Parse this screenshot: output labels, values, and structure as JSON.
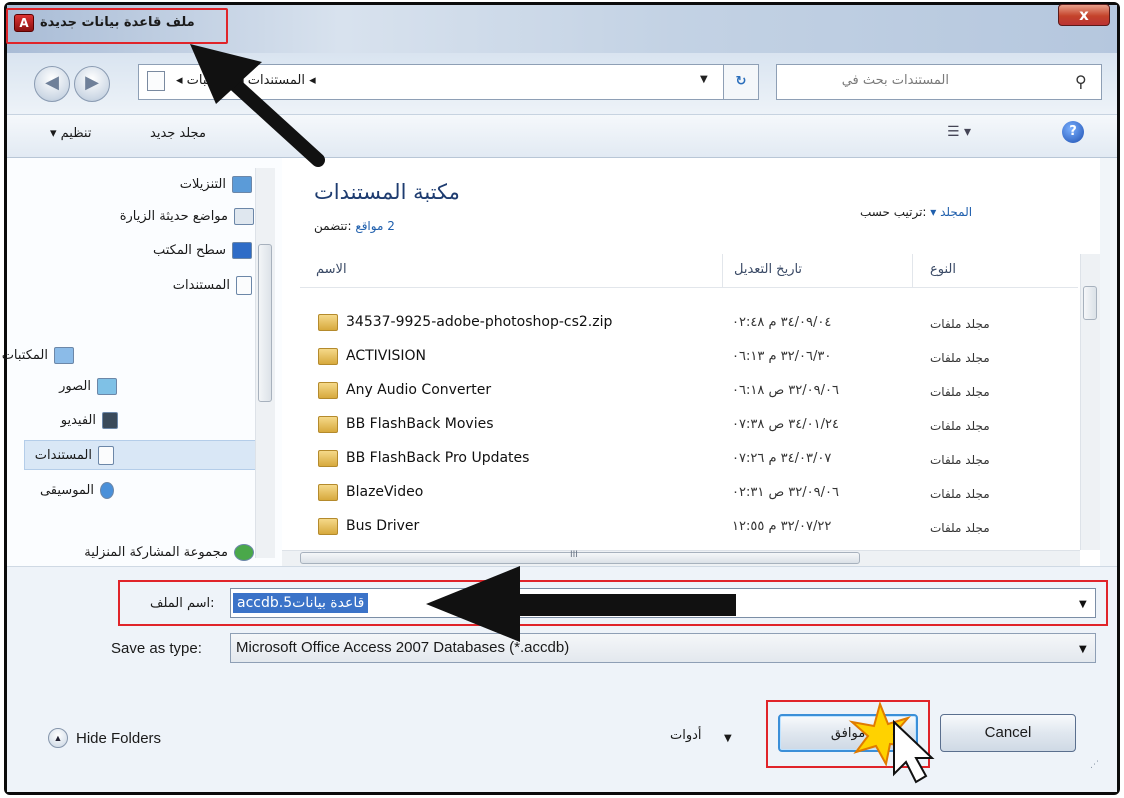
{
  "window": {
    "title": "ملف قاعدة بيانات جديدة",
    "close_label": "x"
  },
  "address": {
    "crumbs": "◂ المستندات ◂ المكتبات ◂",
    "search_placeholder": "المستندات بحث في"
  },
  "toolbar": {
    "organize": "تنظيم ▾",
    "new_folder": "مجلد جديد"
  },
  "sidebar": {
    "items": [
      {
        "label": "التنزيلات",
        "icon": "downloads-icon"
      },
      {
        "label": "مواضع حديثة الزيارة",
        "icon": "recent-places-icon"
      },
      {
        "label": "سطح المكتب",
        "icon": "desktop-icon"
      },
      {
        "label": "المستندات",
        "icon": "document-icon"
      },
      {
        "label": "المكتبات",
        "icon": "libraries-icon"
      },
      {
        "label": "الصور",
        "icon": "pictures-icon"
      },
      {
        "label": "الفيديو",
        "icon": "video-icon"
      },
      {
        "label": "المستندات",
        "icon": "document-icon"
      },
      {
        "label": "الموسيقى",
        "icon": "music-icon"
      },
      {
        "label": "مجموعة المشاركة المنزلية",
        "icon": "homegroup-icon"
      }
    ]
  },
  "library": {
    "title": "مكتبة المستندات",
    "includes_label": ":تتضمن",
    "includes_value": "2 مواقع",
    "arrange_label": ":ترتيب حسب",
    "arrange_value": "المجلد ▾"
  },
  "columns": {
    "name": "الاسم",
    "date": "تاريخ التعديل",
    "type": "النوع"
  },
  "files": [
    {
      "name": "34537-9925-adobe-photoshop-cs2.zip",
      "date": "٣٤/٠٩/٠٤ م ٠٢:٤٨",
      "type": "مجلد ملفات"
    },
    {
      "name": "ACTIVISION",
      "date": "٣٢/٠٦/٣٠ م ٠٦:١٣",
      "type": "مجلد ملفات"
    },
    {
      "name": "Any Audio Converter",
      "date": "٣٢/٠٩/٠٦ ص ٠٦:١٨",
      "type": "مجلد ملفات"
    },
    {
      "name": "BB FlashBack Movies",
      "date": "٣٤/٠١/٢٤ ص ٠٧:٣٨",
      "type": "مجلد ملفات"
    },
    {
      "name": "BB FlashBack Pro Updates",
      "date": "٣٤/٠٣/٠٧ م ٠٧:٢٦",
      "type": "مجلد ملفات"
    },
    {
      "name": "BlazeVideo",
      "date": "٣٢/٠٩/٠٦ ص ٠٢:٣١",
      "type": "مجلد ملفات"
    },
    {
      "name": "Bus Driver",
      "date": "٣٢/٠٧/٢٢ م ١٢:٥٥",
      "type": "مجلد ملفات"
    }
  ],
  "form": {
    "filename_label": ":اسم الملف",
    "filename_value": "قاعدة بيانات5.accdb",
    "type_label": "Save as type:",
    "type_value": "Microsoft Office Access 2007 Databases (*.accdb)"
  },
  "footer": {
    "hide_folders": "Hide Folders",
    "tools": "أدوات",
    "ok": "موافق",
    "cancel": "Cancel"
  },
  "colors": {
    "highlight": "#e0242a",
    "link_blue": "#1f5fad",
    "selection": "#3b73c8"
  }
}
